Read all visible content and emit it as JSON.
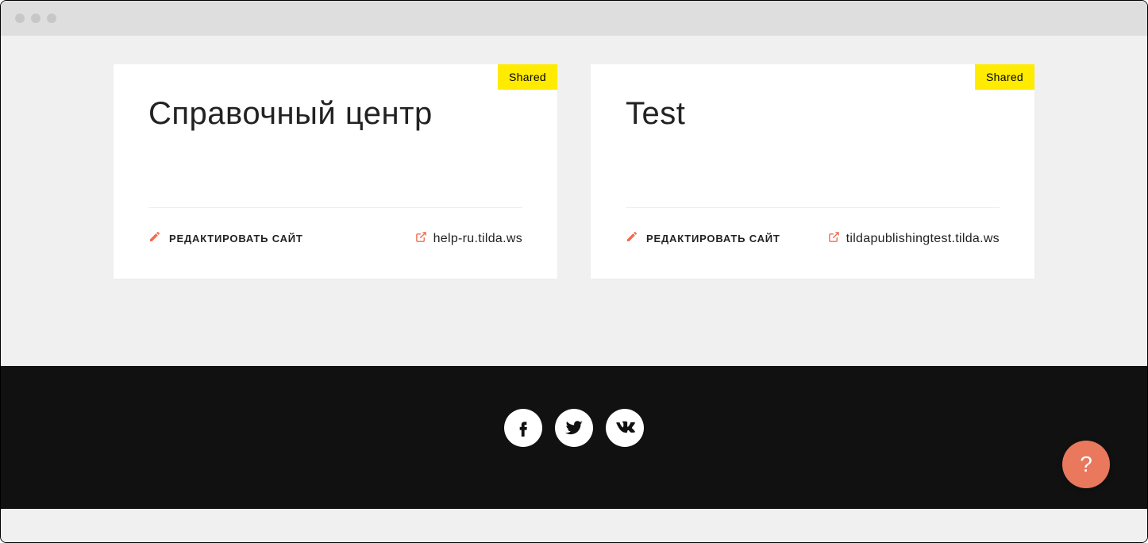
{
  "cards": [
    {
      "shared_label": "Shared",
      "title": "Справочный центр",
      "edit_label": "РЕДАКТИРОВАТЬ САЙТ",
      "site_url": "help-ru.tilda.ws"
    },
    {
      "shared_label": "Shared",
      "title": "Test",
      "edit_label": "РЕДАКТИРОВАТЬ САЙТ",
      "site_url": "tildapublishingtest.tilda.ws"
    }
  ],
  "social": {
    "facebook": "facebook-icon",
    "twitter": "twitter-icon",
    "vk": "vk-icon"
  },
  "help_button": "?"
}
